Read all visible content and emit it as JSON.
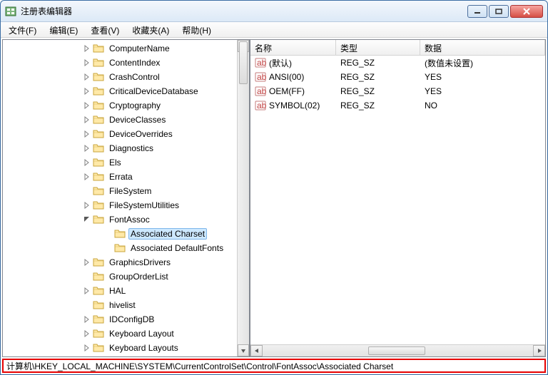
{
  "window": {
    "title": "注册表编辑器"
  },
  "menu": {
    "file": "文件(F)",
    "edit": "编辑(E)",
    "view": "查看(V)",
    "favorites": "收藏夹(A)",
    "help": "帮助(H)"
  },
  "tree": {
    "indent_base": 110,
    "child_indent": 140,
    "items": [
      {
        "label": "ComputerName",
        "expandable": true
      },
      {
        "label": "ContentIndex",
        "expandable": true
      },
      {
        "label": "CrashControl",
        "expandable": true
      },
      {
        "label": "CriticalDeviceDatabase",
        "expandable": true
      },
      {
        "label": "Cryptography",
        "expandable": true
      },
      {
        "label": "DeviceClasses",
        "expandable": true
      },
      {
        "label": "DeviceOverrides",
        "expandable": true
      },
      {
        "label": "Diagnostics",
        "expandable": true
      },
      {
        "label": "Els",
        "expandable": true
      },
      {
        "label": "Errata",
        "expandable": true
      },
      {
        "label": "FileSystem",
        "expandable": false
      },
      {
        "label": "FileSystemUtilities",
        "expandable": true
      },
      {
        "label": "FontAssoc",
        "expandable": true,
        "expanded": true,
        "children": [
          {
            "label": "Associated Charset",
            "selected": true
          },
          {
            "label": "Associated DefaultFonts"
          }
        ]
      },
      {
        "label": "GraphicsDrivers",
        "expandable": true
      },
      {
        "label": "GroupOrderList",
        "expandable": false
      },
      {
        "label": "HAL",
        "expandable": true
      },
      {
        "label": "hivelist",
        "expandable": false
      },
      {
        "label": "IDConfigDB",
        "expandable": true
      },
      {
        "label": "Keyboard Layout",
        "expandable": true
      },
      {
        "label": "Keyboard Layouts",
        "expandable": true
      }
    ]
  },
  "list": {
    "columns": {
      "name": "名称",
      "type": "类型",
      "data": "数据"
    },
    "rows": [
      {
        "name": "(默认)",
        "type": "REG_SZ",
        "data": "(数值未设置)"
      },
      {
        "name": "ANSI(00)",
        "type": "REG_SZ",
        "data": "YES"
      },
      {
        "name": "OEM(FF)",
        "type": "REG_SZ",
        "data": "YES"
      },
      {
        "name": "SYMBOL(02)",
        "type": "REG_SZ",
        "data": "NO"
      }
    ]
  },
  "statusbar": {
    "path": "计算机\\HKEY_LOCAL_MACHINE\\SYSTEM\\CurrentControlSet\\Control\\FontAssoc\\Associated Charset"
  }
}
